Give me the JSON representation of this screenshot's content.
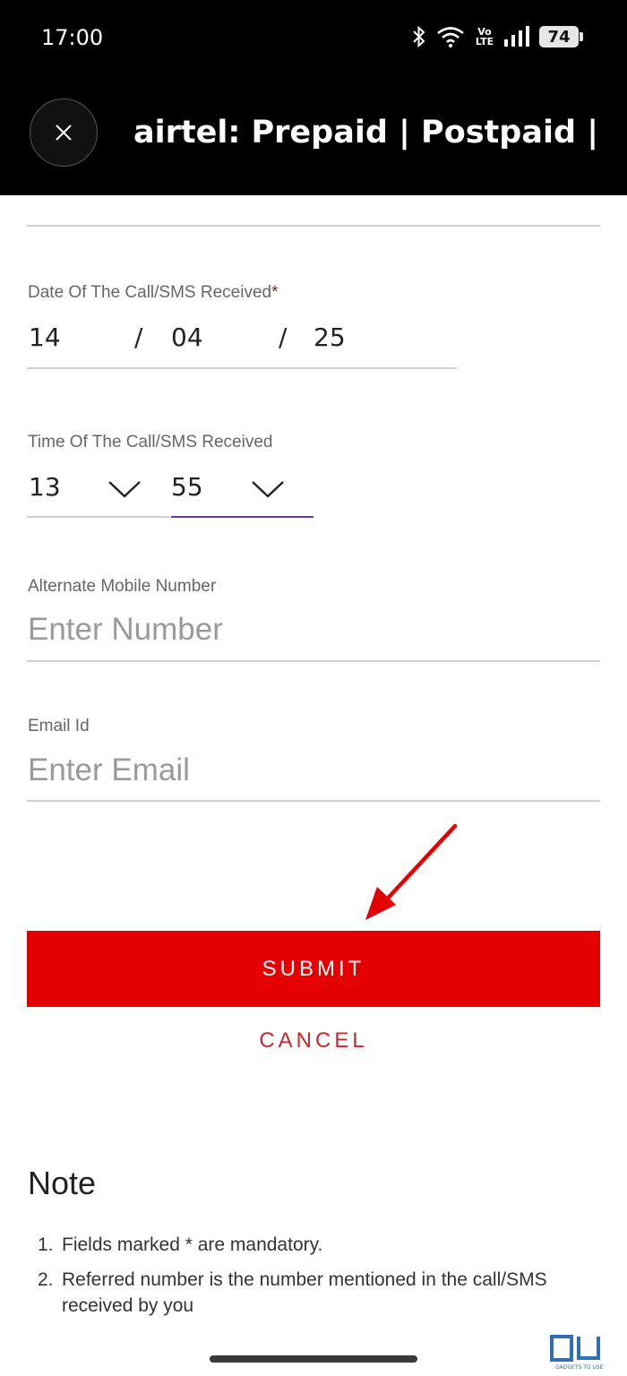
{
  "status_bar": {
    "time": "17:00",
    "network_label": "Vo LTE",
    "battery": "74",
    "wifi_label": "5"
  },
  "header": {
    "title": "airtel: Prepaid | Postpaid |..."
  },
  "form": {
    "date_label": "Date Of The Call/SMS Received",
    "date_required_mark": "*",
    "date_day": "14",
    "date_month": "04",
    "date_year": "25",
    "date_separator": "/",
    "time_label": "Time Of The Call/SMS Received",
    "time_hour": "13",
    "time_minute": "55",
    "alt_mobile_label": "Alternate Mobile Number",
    "alt_mobile_placeholder": "Enter Number",
    "email_label": "Email Id",
    "email_placeholder": "Enter Email"
  },
  "actions": {
    "submit_label": "SUBMIT",
    "cancel_label": "CANCEL",
    "submit_color": "#e40000",
    "cancel_color": "#c8282d"
  },
  "note": {
    "title": "Note",
    "items": [
      {
        "num": "1.",
        "text": "Fields marked * are mandatory."
      },
      {
        "num": "2.",
        "text": "Referred number is the number mentioned in the call/SMS received by you"
      }
    ]
  },
  "watermark": {
    "logo": "GU",
    "caption": "GADGETS TO USE"
  }
}
